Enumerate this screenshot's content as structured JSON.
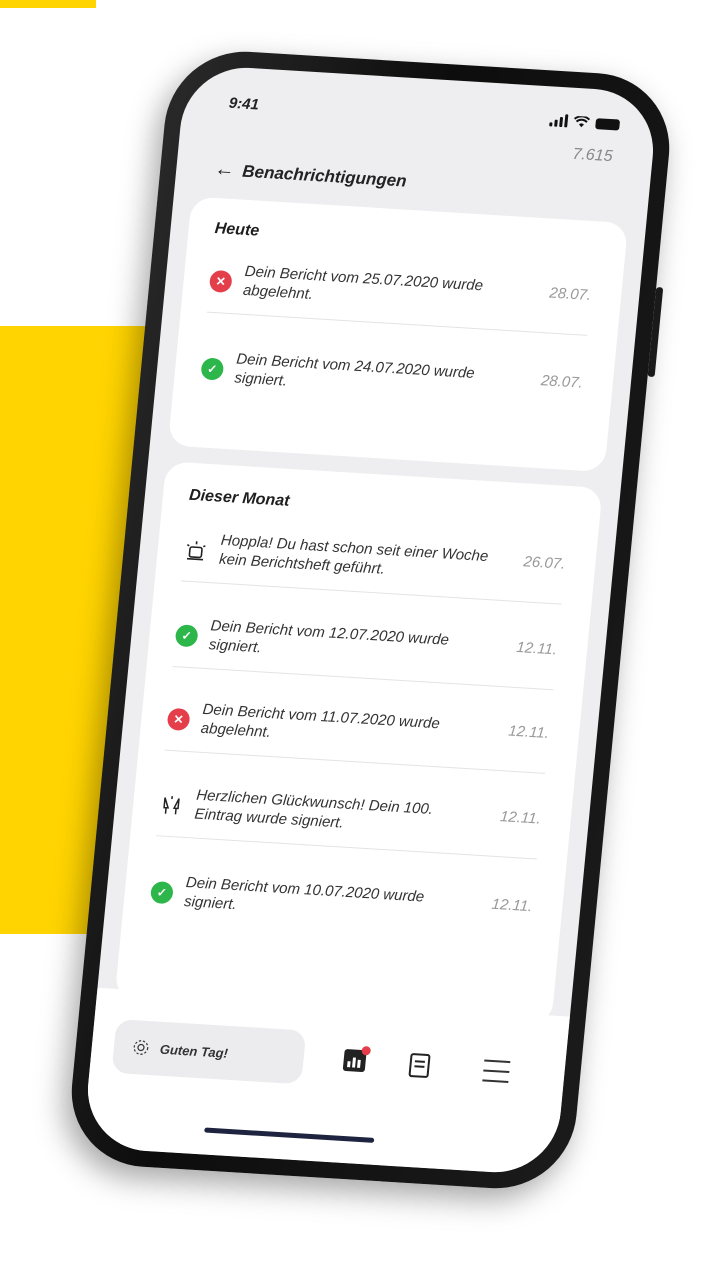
{
  "status": {
    "time": "9:41"
  },
  "header": {
    "title": "Benachrichtigungen",
    "counter": "7.615"
  },
  "sections": [
    {
      "title": "Heute",
      "items": [
        {
          "icon": "rejected-icon",
          "text": "Dein Bericht vom 25.07.2020 wurde abgelehnt.",
          "date": "28.07."
        },
        {
          "icon": "signed-icon",
          "text": "Dein Bericht vom 24.07.2020 wurde signiert.",
          "date": "28.07."
        }
      ]
    },
    {
      "title": "Dieser Monat",
      "items": [
        {
          "icon": "alarm-icon",
          "text": "Hoppla! Du hast schon seit einer Woche kein Berichtsheft geführt.",
          "date": "26.07."
        },
        {
          "icon": "signed-icon",
          "text": "Dein Bericht vom 12.07.2020 wurde signiert.",
          "date": "12.11."
        },
        {
          "icon": "rejected-icon",
          "text": "Dein Bericht vom 11.07.2020 wurde abgelehnt.",
          "date": "12.11."
        },
        {
          "icon": "celebration-icon",
          "text": "Herzlichen Glückwunsch! Dein 100. Eintrag wurde signiert.",
          "date": "12.11."
        },
        {
          "icon": "signed-icon",
          "text": "Dein Bericht vom 10.07.2020 wurde signiert.",
          "date": "12.11."
        }
      ]
    }
  ],
  "bottom_nav": {
    "greeting": "Guten Tag!",
    "items": [
      "chart-icon",
      "book-icon",
      "menu-icon"
    ]
  },
  "colors": {
    "accent_yellow": "#FFD400",
    "rejected": "#E53E4B",
    "signed": "#2DB64A"
  }
}
